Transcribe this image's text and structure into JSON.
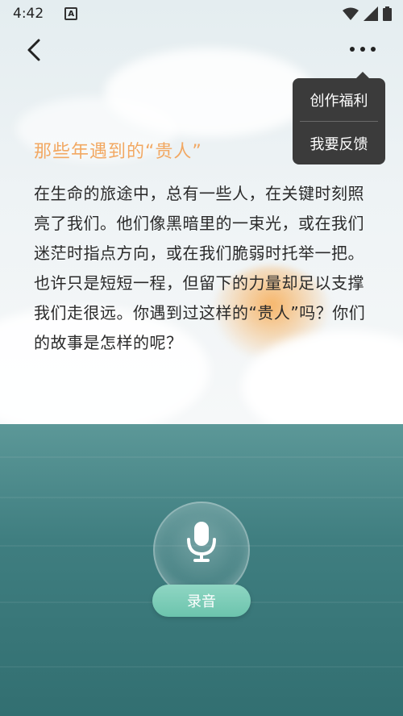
{
  "status_bar": {
    "time": "4:42",
    "notification_glyph": "A",
    "icons": [
      "wifi-icon",
      "signal-icon",
      "battery-icon"
    ]
  },
  "header": {
    "back_icon": "chevron-left-icon",
    "more_icon": "more-dots-icon"
  },
  "menu": {
    "items": [
      {
        "label": "创作福利"
      },
      {
        "label": "我要反馈"
      }
    ]
  },
  "article": {
    "title": "那些年遇到的“贵人”",
    "body": "在生命的旅途中，总有一些人，在关键时刻照亮了我们。他们像黑暗里的一束光，或在我们迷茫时指点方向，或在我们脆弱时托举一把。也许只是短短一程，但留下的力量却足以支撑我们走很远。你遇到过这样的“贵人”吗？你们的故事是怎样的呢？"
  },
  "recorder": {
    "label": "录音",
    "icon": "microphone-icon"
  },
  "colors": {
    "title": "#f2a862",
    "sea": "#3f7e80",
    "record_button": "#7ccdb8",
    "menu_background": "#3b3b3b"
  }
}
